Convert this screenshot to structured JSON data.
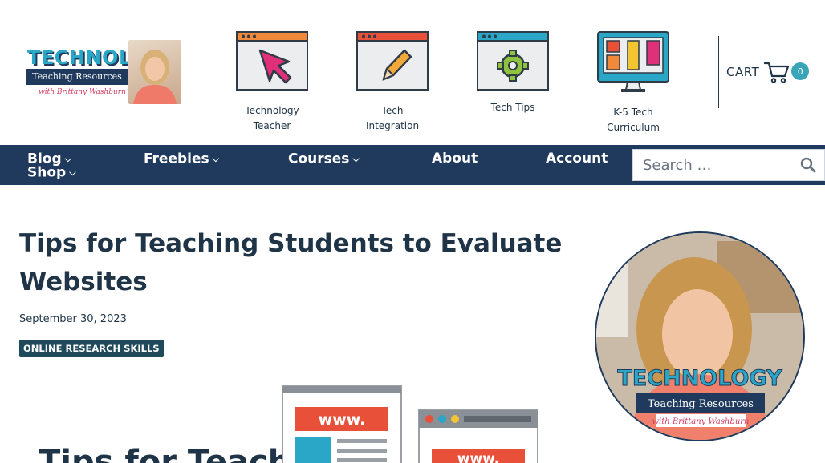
{
  "header": {
    "logo": {
      "word": "TECHNOLOGY",
      "subtitle": "Teaching Resources",
      "byline": "with Brittany Washburn"
    },
    "nav_icons": [
      {
        "label": "Technology Teacher",
        "icon": "pointer-arrow-window-icon"
      },
      {
        "label": "Tech Integration",
        "icon": "pencil-window-icon"
      },
      {
        "label": "Tech Tips",
        "icon": "gear-window-icon"
      },
      {
        "label": "K-5 Tech Curriculum",
        "icon": "monitor-blocks-icon"
      }
    ],
    "cart": {
      "label": "CART",
      "count": "0"
    }
  },
  "nav": {
    "items": [
      {
        "label": "Blog",
        "dropdown": true
      },
      {
        "label": "Shop",
        "dropdown": true
      },
      {
        "label": "Freebies",
        "dropdown": true
      },
      {
        "label": "Courses",
        "dropdown": true
      },
      {
        "label": "About",
        "dropdown": false
      },
      {
        "label": "Account",
        "dropdown": false
      }
    ],
    "search": {
      "placeholder": "Search …"
    }
  },
  "article": {
    "title": "Tips for Teaching Students to Evaluate Websites",
    "date": "September 30, 2023",
    "category": "ONLINE RESEARCH SKILLS",
    "feature_image": {
      "browser_text": "www."
    }
  },
  "sidebar": {
    "logo": {
      "word": "TECHNOLOGY",
      "subtitle": "Teaching Resources",
      "byline": "with Brittany Washburn"
    }
  },
  "colors": {
    "navy": "#1f3a5c",
    "teal": "#2aa7c6",
    "pink": "#e0307a",
    "orange": "#f08a3a",
    "red": "#e8503a",
    "yellow": "#f3c531",
    "green": "#8fc23f"
  }
}
